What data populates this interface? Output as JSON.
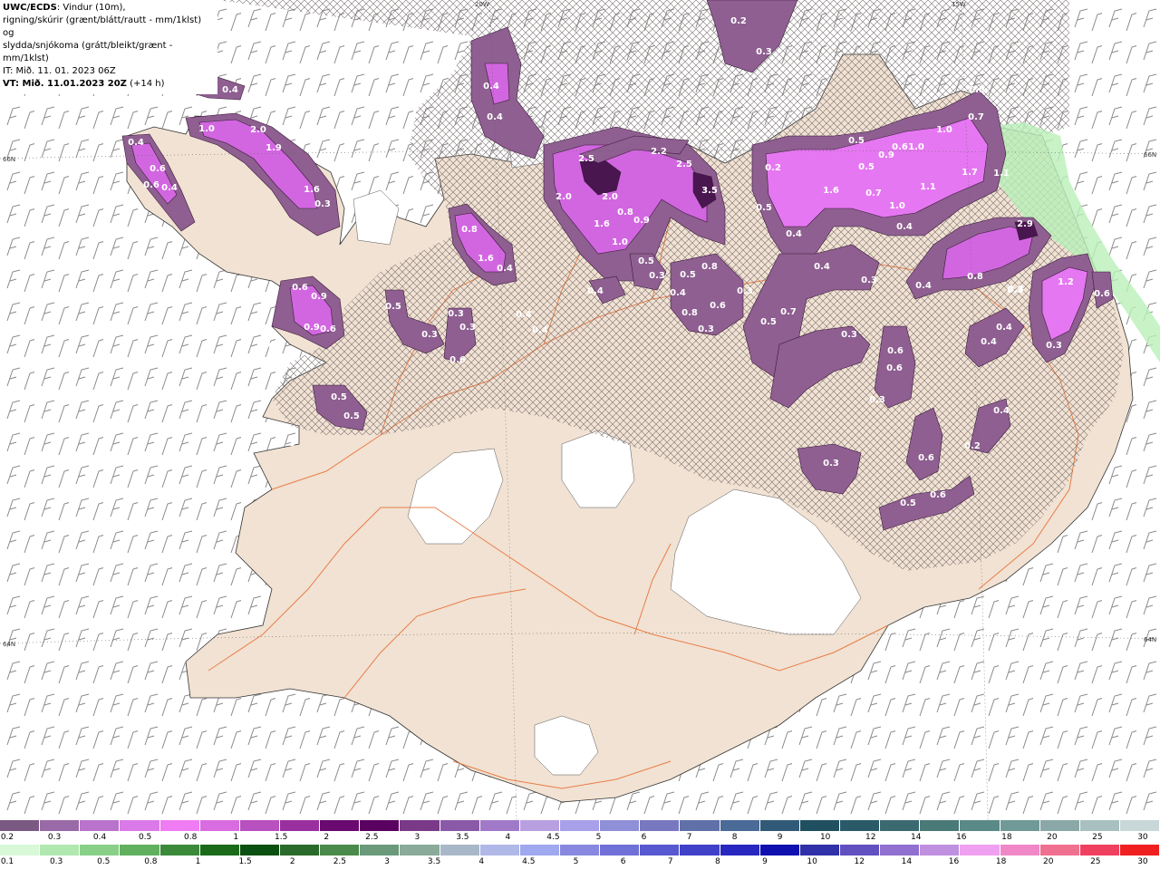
{
  "header": {
    "line1_bold": "UWC/ECDS",
    "line1_rest": ": Vindur (10m),",
    "line2": "rigning/skúrir (grænt/blátt/rautt - mm/1klst) og",
    "line3": "slydda/snjókoma (grátt/bleikt/grænt - mm/1klst)",
    "line4": "IT: Mið. 11. 01. 2023 06Z",
    "line5_bold": "VT: Mið. 11.01.2023 20Z",
    "line5_rest": " (+14 h)"
  },
  "grid_labels": {
    "top_left": "20W",
    "top_right": "15W",
    "left_upper": "66N",
    "left_lower": "64N",
    "right_upper": "66N",
    "right_lower": "64N"
  },
  "precip_labels": [
    "0.4",
    "0.4",
    "1.0",
    "2.0",
    "1.9",
    "0.4",
    "0.6",
    "1.6",
    "0.3",
    "0.4",
    "0.6",
    "0.6",
    "0.9",
    "0.9",
    "0.6",
    "0.3",
    "0.5",
    "0.5",
    "0.3",
    "0.3",
    "0.5",
    "0.8",
    "1.6",
    "0.4",
    "0.4",
    "0.4",
    "0.6",
    "0.3",
    "0.3",
    "0.4",
    "0.4",
    "2.5",
    "2.0",
    "1.6",
    "2.0",
    "0.8",
    "2.2",
    "2.5",
    "3.5",
    "0.9",
    "1.0",
    "0.5",
    "0.3",
    "0.4",
    "0.5",
    "0.8",
    "0.4",
    "0.8",
    "0.6",
    "0.3",
    "0.3",
    "0.2",
    "0.3",
    "0.2",
    "1.6",
    "0.5",
    "0.4",
    "0.5",
    "0.6",
    "0.9",
    "1.0",
    "1.0",
    "0.7",
    "1.0",
    "0.4",
    "1.1",
    "1.7",
    "1.1",
    "0.5",
    "0.7",
    "0.5",
    "2.9",
    "0.8",
    "0.4",
    "0.3",
    "0.5",
    "0.7",
    "0.4",
    "0.6",
    "0.6",
    "0.3",
    "0.4",
    "0.3",
    "0.3",
    "0.3",
    "1.2",
    "0.6",
    "0.3",
    "0.4",
    "0.4",
    "0.2",
    "0.6",
    "0.5",
    "0.6",
    "0.3"
  ],
  "colors": {
    "land": "#f1e2d3",
    "sea": "#ffffff",
    "roads": "#e8733a",
    "snow_light": "#8e5f90",
    "snow_mid": "#b96bd0",
    "snow_heavy": "#e677f2",
    "snow_peak": "#4a1650",
    "rain_light": "#b9f0b9"
  },
  "legend_snow": {
    "colors": [
      "#7a5a82",
      "#9a6aa8",
      "#b973cc",
      "#d97ae8",
      "#f07cf4",
      "#d86ce0",
      "#b850c0",
      "#9a30a0",
      "#6a0a70",
      "#5a0060",
      "#7a3a88",
      "#8a5aa8",
      "#a07ac8",
      "#b8a0e0",
      "#a8a0e8",
      "#9090d8",
      "#7878c0",
      "#6070a8",
      "#4a6a98",
      "#305a78",
      "#205060",
      "#2a5a68",
      "#3a6a70",
      "#4a7a78",
      "#5a8a88",
      "#709a98",
      "#8aa8a8",
      "#a8c0c0",
      "#c8d8d8"
    ],
    "labels": [
      "0.2",
      "0.3",
      "0.4",
      "0.5",
      "0.8",
      "1",
      "1.5",
      "2",
      "2.5",
      "3",
      "3.5",
      "4",
      "4.5",
      "5",
      "6",
      "7",
      "8",
      "9",
      "10",
      "12",
      "14",
      "16",
      "18",
      "20",
      "25",
      "30"
    ]
  },
  "legend_rain": {
    "colors": [
      "#d8f8d8",
      "#b0e8b0",
      "#88d088",
      "#60b060",
      "#3a8a3a",
      "#1a6a1a",
      "#0a5010",
      "#2a6a2a",
      "#4a8a4a",
      "#6a9a7a",
      "#8aaa9a",
      "#a8b8c8",
      "#b0b8e8",
      "#a0a8f0",
      "#8888e0",
      "#7070d8",
      "#5858d0",
      "#4040c8",
      "#2828c0",
      "#1010b0",
      "#3030a8",
      "#6050c0",
      "#9070d0",
      "#c090e0",
      "#f0a0f0",
      "#f088c8",
      "#f07090",
      "#f04060",
      "#f02020"
    ],
    "labels": [
      "0.1",
      "0.3",
      "0.5",
      "0.8",
      "1",
      "1.5",
      "2",
      "2.5",
      "3",
      "3.5",
      "4",
      "4.5",
      "5",
      "6",
      "7",
      "8",
      "9",
      "10",
      "12",
      "14",
      "16",
      "18",
      "20",
      "25",
      "30"
    ]
  }
}
